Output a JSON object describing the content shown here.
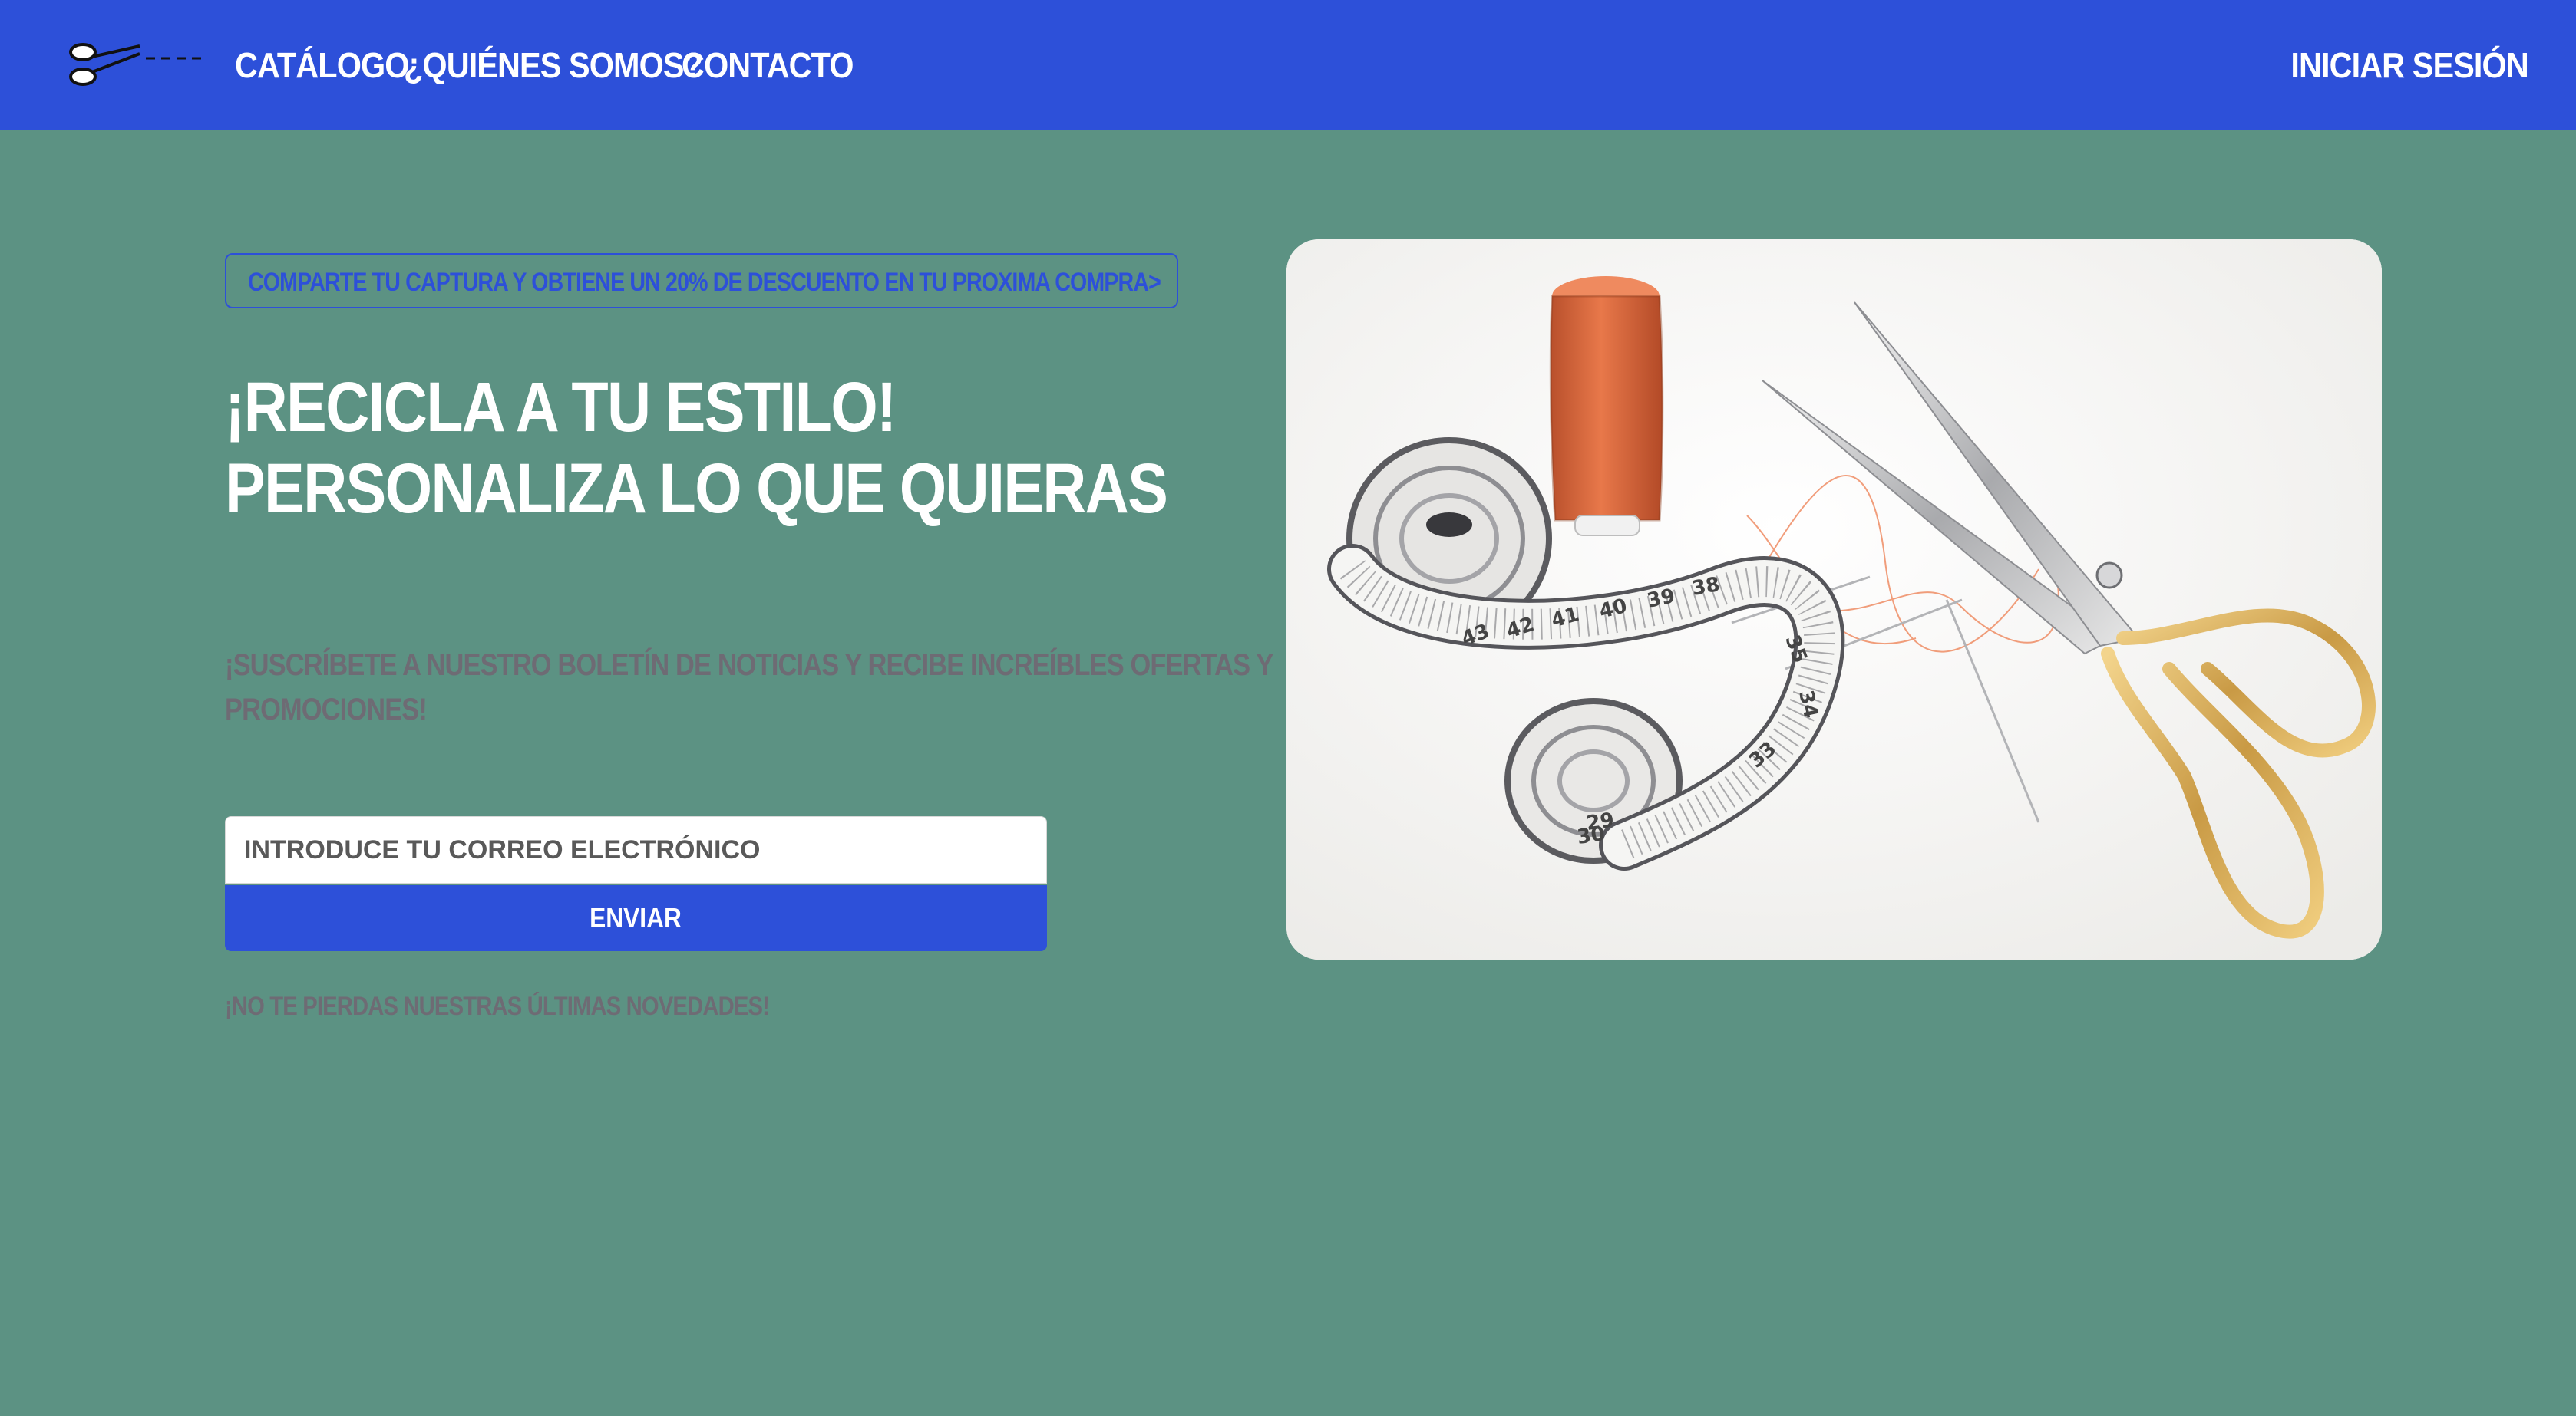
{
  "colors": {
    "background": "#5c9283",
    "navbar": "#2d50d9",
    "accent": "#2d50d9",
    "nav_text": "#ffffff",
    "muted_text": "#6e6b74"
  },
  "navbar": {
    "logo_icon": "scissors-cut-line-icon",
    "links": [
      {
        "label": "CATÁLOGO"
      },
      {
        "label": "¿QUIÉNES SOMOS?"
      },
      {
        "label": "CONTACTO"
      }
    ],
    "login_label": "INICIAR SESIÓN"
  },
  "promo": {
    "text": "COMPARTE TU CAPTURA Y OBTIENE UN 20% DE DESCUENTO EN TU PROXIMA COMPRA>"
  },
  "hero": {
    "title_line1": "¡RECICLA A TU ESTILO!",
    "title_line2": "PERSONALIZA LO QUE QUIERAS",
    "subscribe_line1": "¡SUSCRÍBETE A NUESTRO BOLETÍN DE NOTICIAS Y RECIBE INCREÍBLES OFERTAS Y",
    "subscribe_line2": "PROMOCIONES!",
    "image_icon": "sewing-supplies-image"
  },
  "form": {
    "email_placeholder": "INTRODUCE TU CORREO ELECTRÓNICO",
    "email_value": "",
    "submit_label": "ENVIAR",
    "footnote": "¡NO TE PIERDAS NUESTRAS ÚLTIMAS NOVEDADES!"
  },
  "tape_numbers": [
    "30",
    "29",
    "43",
    "42",
    "41",
    "40",
    "39",
    "38",
    "35",
    "34",
    "33"
  ]
}
